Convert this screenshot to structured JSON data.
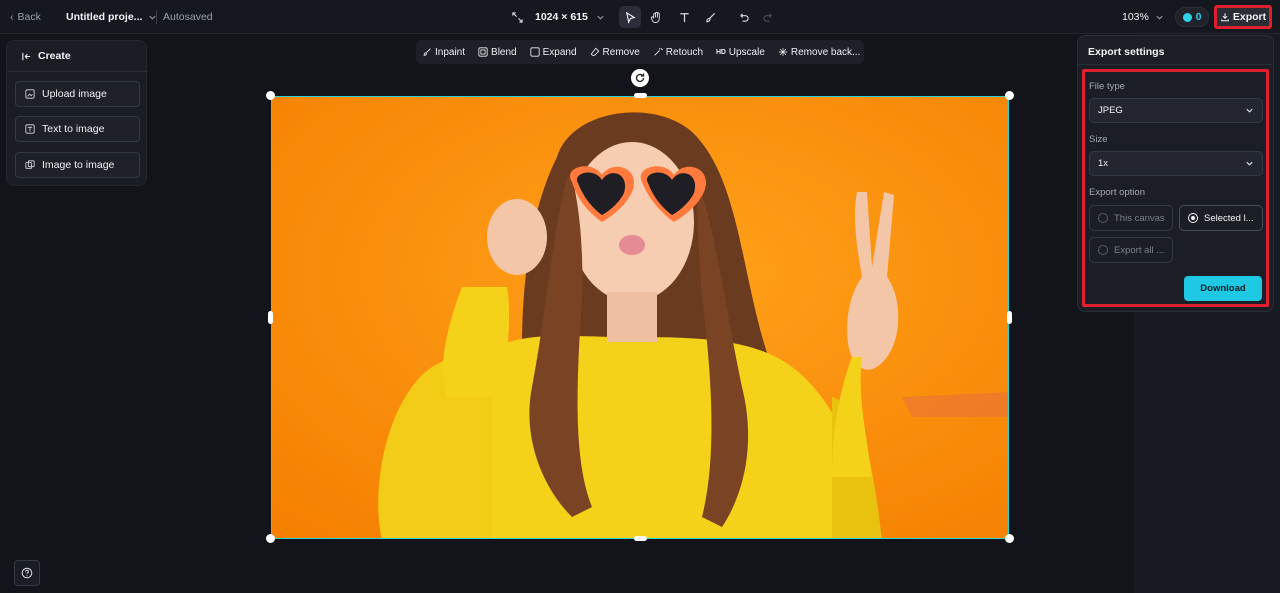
{
  "topbar": {
    "back_label": "Back",
    "project_name": "Untitled proje...",
    "autosave_status": "Autosaved",
    "canvas_size": "1024 × 615",
    "zoom": "103%",
    "credits": "0",
    "export_label": "Export"
  },
  "create_panel": {
    "title": "Create",
    "items": [
      {
        "label": "Upload image"
      },
      {
        "label": "Text to image"
      },
      {
        "label": "Image to image"
      }
    ]
  },
  "edit_toolbar": {
    "items": [
      {
        "label": "Inpaint"
      },
      {
        "label": "Blend"
      },
      {
        "label": "Expand"
      },
      {
        "label": "Remove"
      },
      {
        "label": "Retouch"
      },
      {
        "label": "Upscale",
        "prefix": "HD"
      },
      {
        "label": "Remove back..."
      }
    ]
  },
  "export_settings": {
    "title": "Export settings",
    "file_type_label": "File type",
    "file_type_value": "JPEG",
    "size_label": "Size",
    "size_value": "1x",
    "export_option_label": "Export option",
    "options": [
      {
        "label": "This canvas",
        "selected": false
      },
      {
        "label": "Selected l...",
        "selected": true
      },
      {
        "label": "Export all ...",
        "selected": false
      }
    ],
    "download_label": "Download"
  },
  "colors": {
    "accent": "#1fc9e4",
    "highlight": "#e0202e",
    "canvas_bg": "#fb8c00",
    "selection": "#2bd3d9"
  }
}
